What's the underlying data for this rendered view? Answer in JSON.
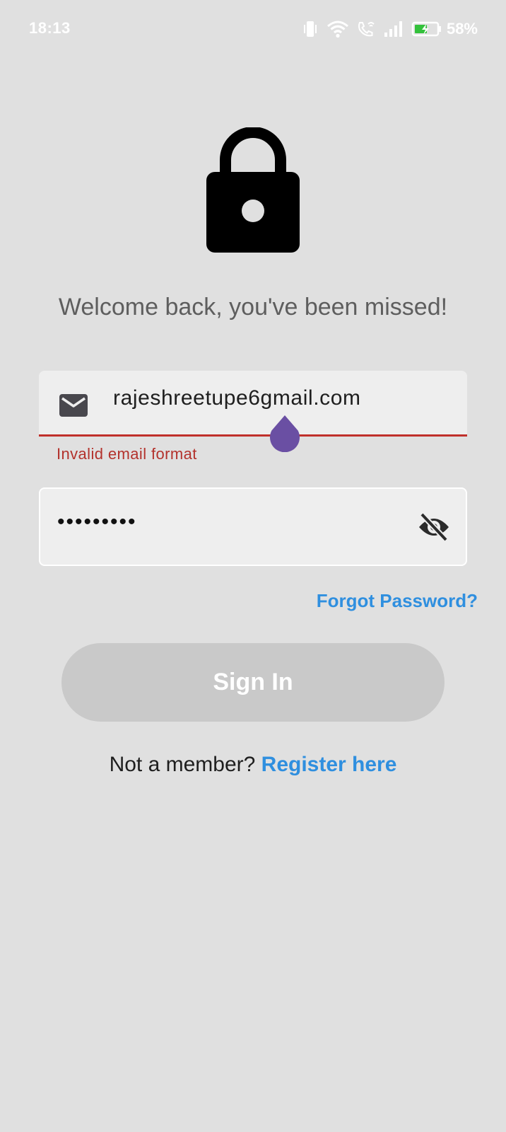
{
  "status_bar": {
    "time": "18:13",
    "battery_percent": "58%",
    "icons": [
      "vibrate-icon",
      "wifi-icon",
      "wifi-calling-icon",
      "signal-icon",
      "battery-charging-icon"
    ]
  },
  "header": {
    "icon": "lock-icon",
    "welcome_text": "Welcome back, you've been missed!"
  },
  "email": {
    "icon": "mail-icon",
    "value": "rajeshreetupe6gmail.com",
    "error": "Invalid email format"
  },
  "password": {
    "masked_value": "•••••••••",
    "toggle_icon": "eye-off-icon"
  },
  "links": {
    "forgot_password": "Forgot Password?"
  },
  "sign_in": {
    "label": "Sign In"
  },
  "register": {
    "prompt": "Not a member?",
    "link": "Register here"
  },
  "colors": {
    "background": "#e0e0e0",
    "accent": "#2f8fdf",
    "error": "#c0302b",
    "button_disabled": "#c9c9c9",
    "cursor_handle": "#6a4fa3"
  }
}
